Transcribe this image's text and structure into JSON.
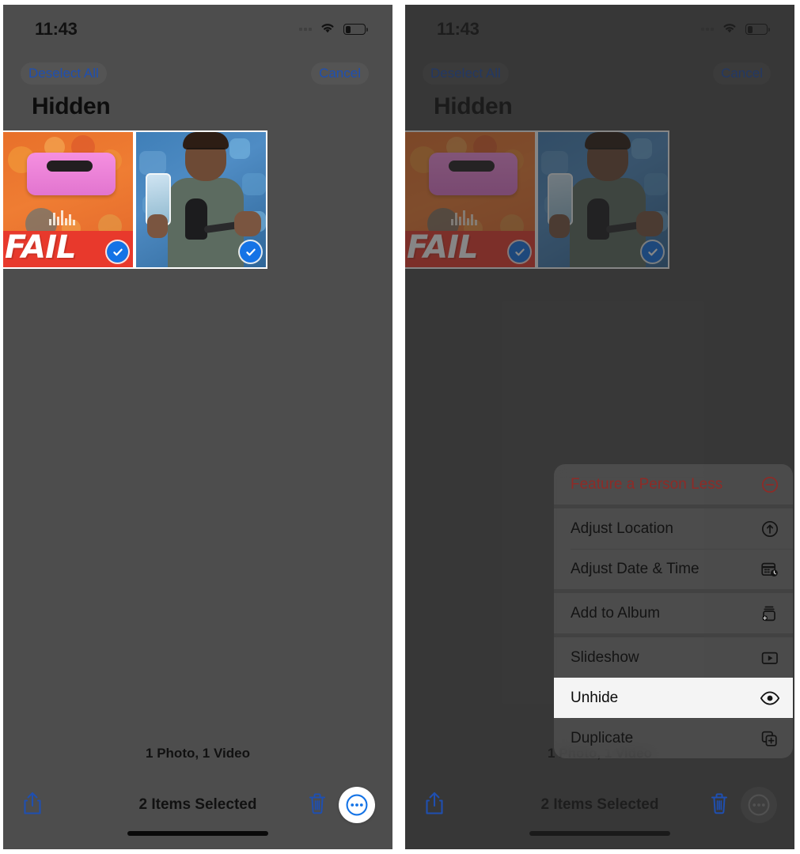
{
  "screenshot": {
    "title": "iOS Photos — Hidden album, selection mode with context menu"
  },
  "status_bar": {
    "time": "11:43",
    "cellular_icon": "cellular-signal-icon",
    "wifi_icon": "wifi-icon",
    "battery_icon": "battery-low-icon",
    "battery_percent": 26
  },
  "nav": {
    "deselect_all_label": "Deselect All",
    "cancel_label": "Cancel"
  },
  "header": {
    "title": "Hidden"
  },
  "grid": {
    "items": [
      {
        "name": "photo-thumbnail-fail-poster",
        "type": "Photo",
        "selected": true,
        "overlay_text": "FAIL"
      },
      {
        "name": "video-thumbnail-person-mic",
        "type": "Video",
        "selected": true,
        "overlay_text": ""
      }
    ]
  },
  "footer": {
    "count_label": "1 Photo, 1 Video",
    "selected_label": "2 Items Selected",
    "share_icon": "share-icon",
    "trash_icon": "trash-icon",
    "more_icon": "more-ellipsis-icon"
  },
  "context_menu": {
    "groups": [
      {
        "rows": [
          {
            "label": "Feature a Person Less",
            "icon": "minus-circle-icon",
            "destructive": true,
            "highlighted": false
          }
        ]
      },
      {
        "rows": [
          {
            "label": "Adjust Location",
            "icon": "location-arrow-circle-icon",
            "destructive": false,
            "highlighted": false
          },
          {
            "label": "Adjust Date & Time",
            "icon": "calendar-clock-icon",
            "destructive": false,
            "highlighted": false
          }
        ]
      },
      {
        "rows": [
          {
            "label": "Add to Album",
            "icon": "add-to-album-icon",
            "destructive": false,
            "highlighted": false
          }
        ]
      },
      {
        "rows": [
          {
            "label": "Slideshow",
            "icon": "slideshow-play-icon",
            "destructive": false,
            "highlighted": false
          },
          {
            "label": "Unhide",
            "icon": "eye-icon",
            "destructive": false,
            "highlighted": true
          },
          {
            "label": "Duplicate",
            "icon": "duplicate-icon",
            "destructive": false,
            "highlighted": false
          }
        ]
      }
    ]
  },
  "colors": {
    "screen_background": "#4d4d4d",
    "accent_blue": "#1f4fb0",
    "selection_blue": "#1473e6",
    "destructive_red": "#8e2b27",
    "highlight_row": "#f4f4f4"
  }
}
